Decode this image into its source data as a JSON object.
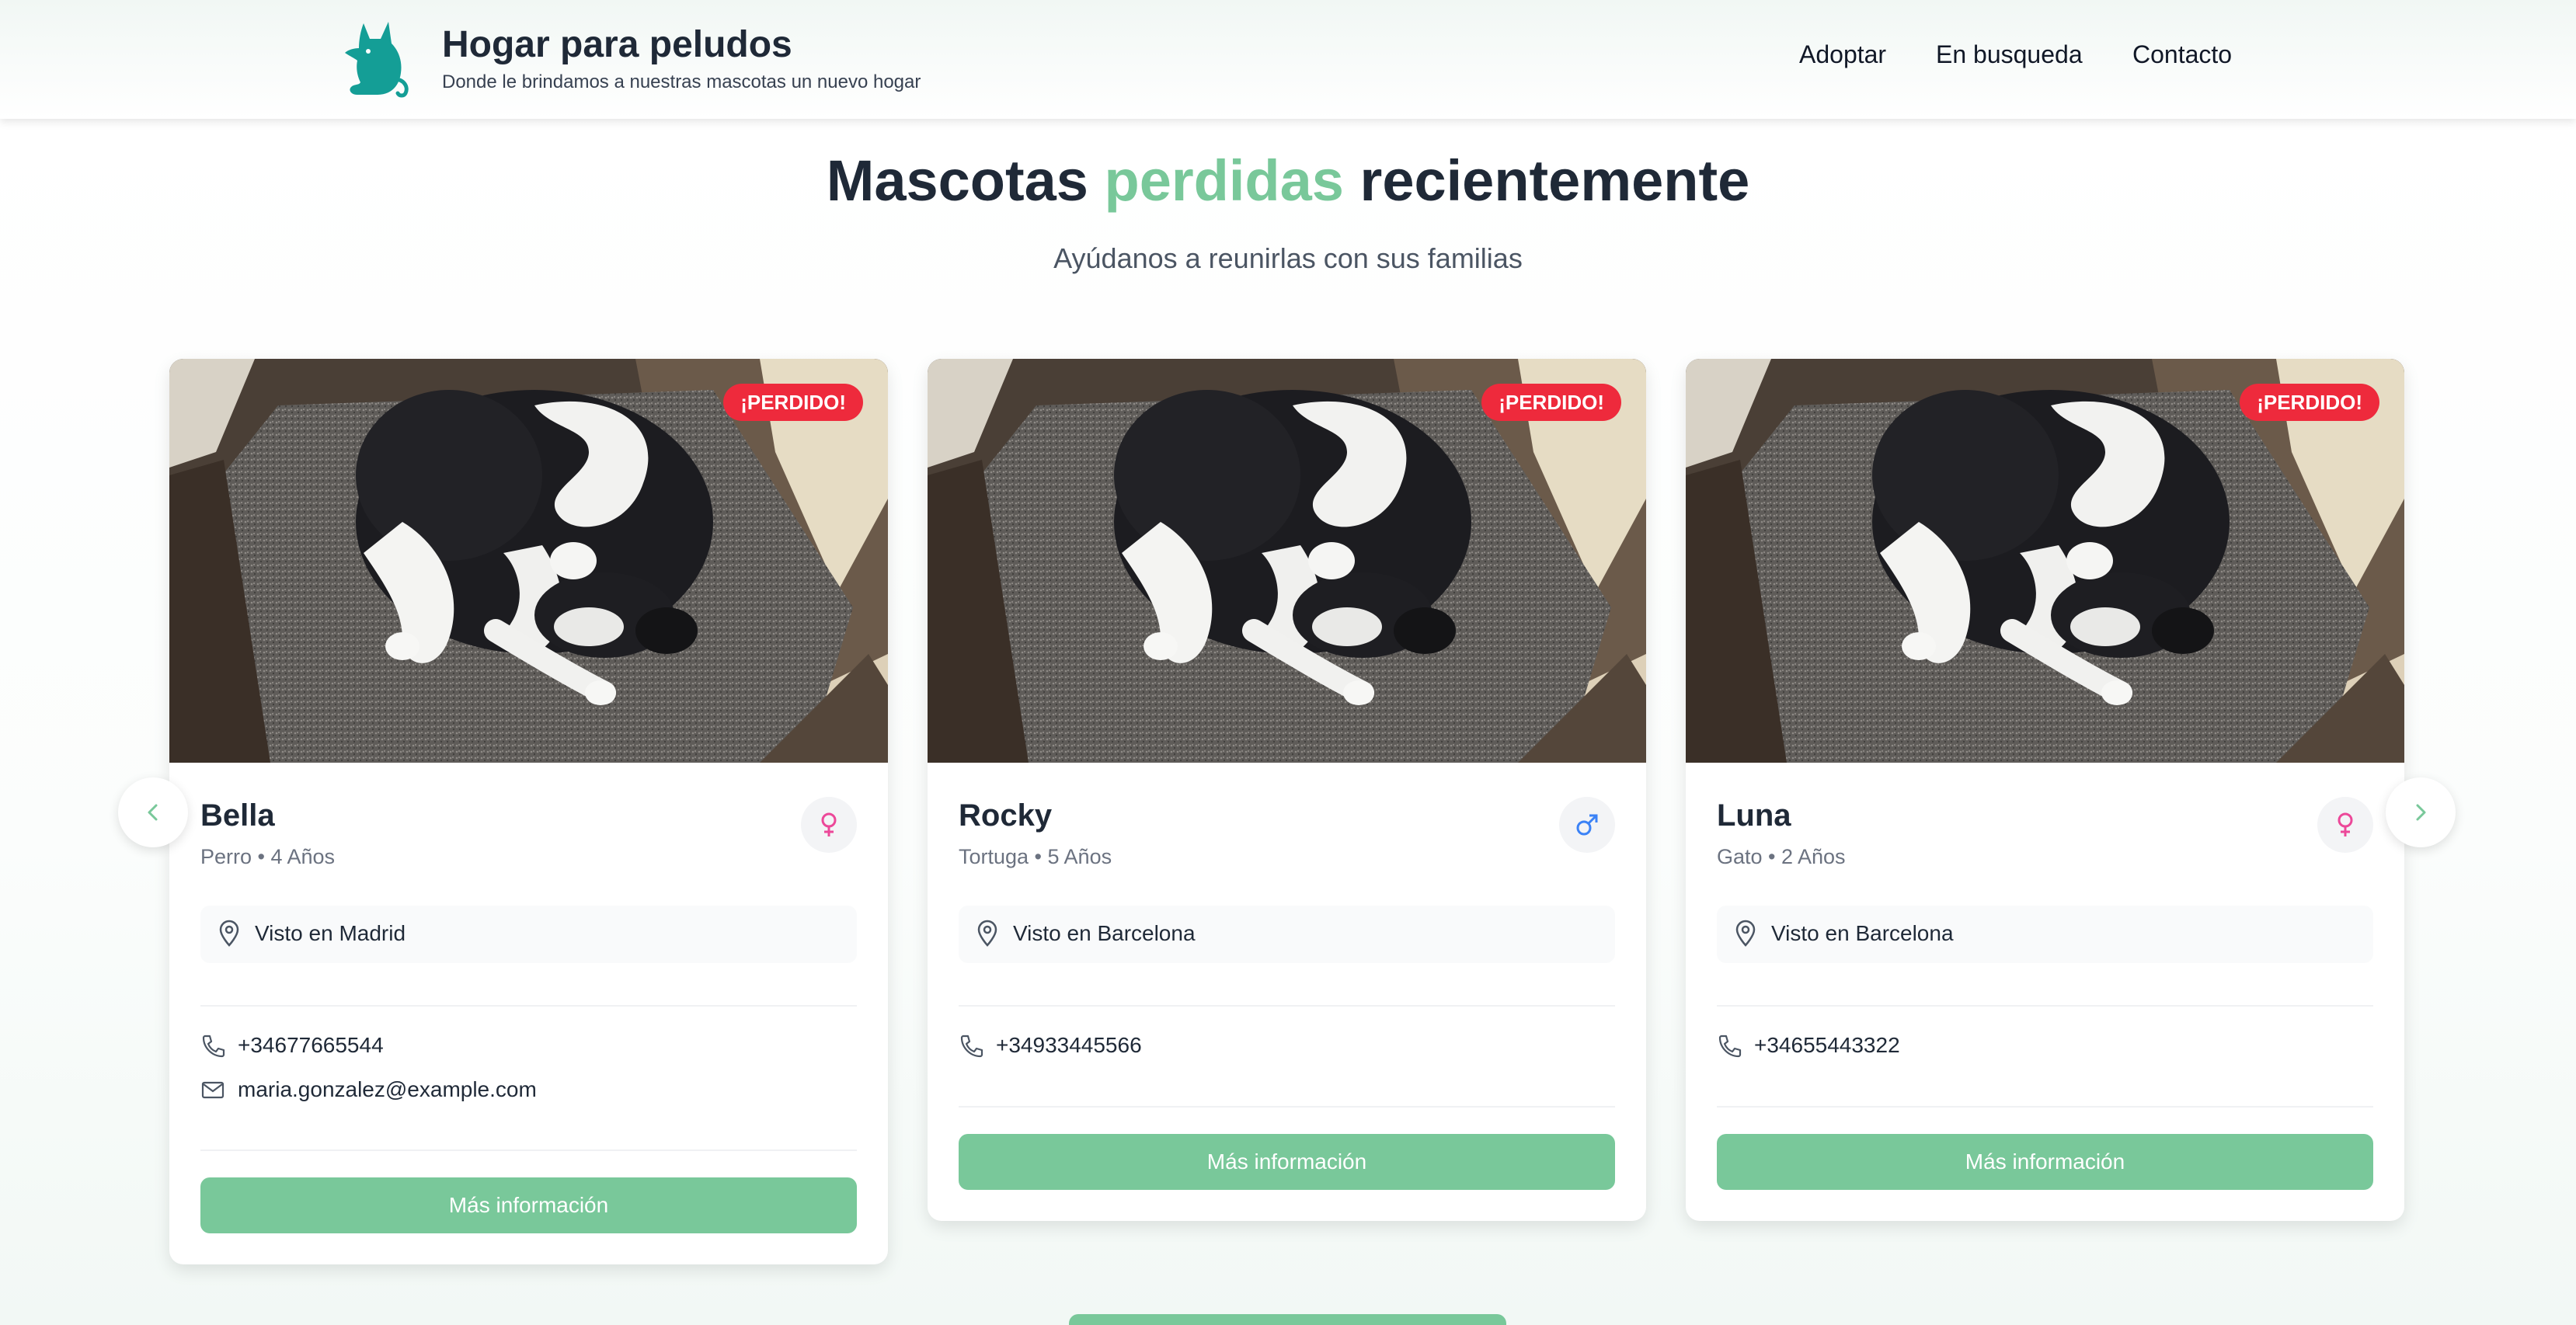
{
  "header": {
    "title": "Hogar para peludos",
    "subtitle": "Donde le brindamos a nuestras mascotas un nuevo hogar",
    "logo_icon": "cat-logo-icon",
    "nav": [
      "Adoptar",
      "En busqueda",
      "Contacto"
    ]
  },
  "hero": {
    "title_part1": "Mascotas",
    "title_accent": "perdidas",
    "title_part2": "recientemente",
    "subtitle": "Ayúdanos a reunirlas con sus familias"
  },
  "colors": {
    "accent": "#79c89a",
    "badge": "#ee2a3c",
    "female": "#ec4899",
    "male": "#3b82f6"
  },
  "cards": [
    {
      "badge": "¡PERDIDO!",
      "name": "Bella",
      "meta": "Perro • 4 Años",
      "gender_icon": "female-icon",
      "location": "Visto en Madrid",
      "phone": "+34677665544",
      "email": "maria.gonzalez@example.com",
      "button": "Más información"
    },
    {
      "badge": "¡PERDIDO!",
      "name": "Rocky",
      "meta": "Tortuga • 5 Años",
      "gender_icon": "male-icon",
      "location": "Visto en Barcelona",
      "phone": "+34933445566",
      "button": "Más información"
    },
    {
      "badge": "¡PERDIDO!",
      "name": "Luna",
      "meta": "Gato • 2 Años",
      "gender_icon": "female-icon",
      "location": "Visto en Barcelona",
      "phone": "+34655443322",
      "button": "Más información"
    }
  ],
  "carousel": {
    "prev_icon": "chevron-left-icon",
    "next_icon": "chevron-right-icon"
  }
}
